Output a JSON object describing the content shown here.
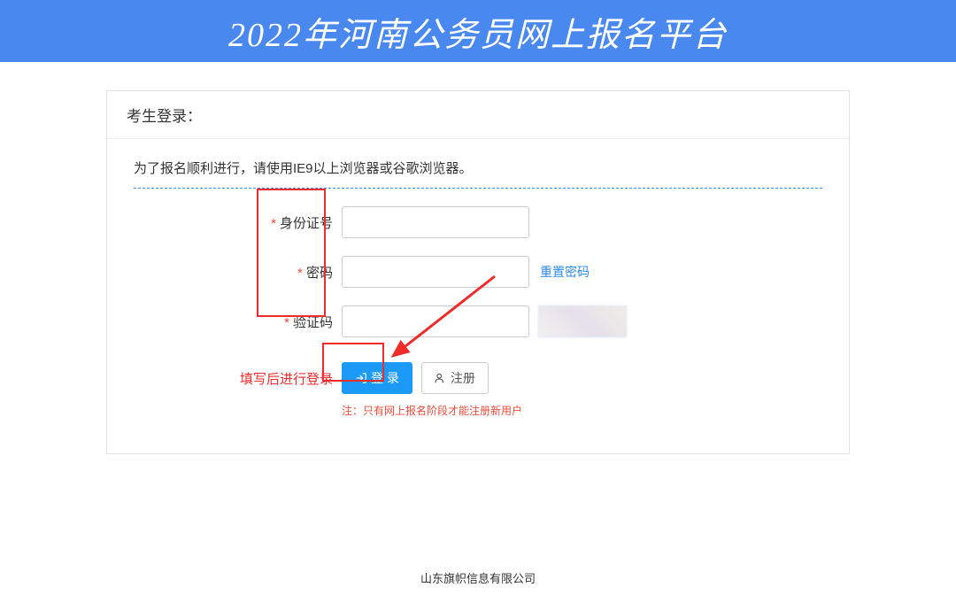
{
  "header": {
    "title": "2022年河南公务员网上报名平台"
  },
  "login": {
    "card_title": "考生登录：",
    "notice": "为了报名顺利进行，请使用IE9以上浏览器或谷歌浏览器。",
    "fields": {
      "id": {
        "label": "身份证号"
      },
      "password": {
        "label": "密码",
        "reset_link": "重置密码"
      },
      "captcha": {
        "label": "验证码"
      }
    },
    "action_hint": "填写后进行登录",
    "buttons": {
      "login": "登 录",
      "register": "注册"
    },
    "sub_note": "注：只有网上报名阶段才能注册新用户"
  },
  "footer": {
    "company": "山东旗帜信息有限公司"
  },
  "annotations": {
    "highlight_labels": true,
    "highlight_login_button": true,
    "arrow_to_login": true
  }
}
